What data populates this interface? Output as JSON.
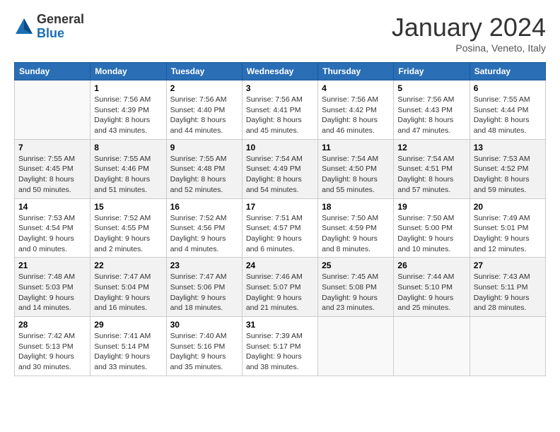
{
  "header": {
    "logo_general": "General",
    "logo_blue": "Blue",
    "month_title": "January 2024",
    "location": "Posina, Veneto, Italy"
  },
  "calendar": {
    "days_of_week": [
      "Sunday",
      "Monday",
      "Tuesday",
      "Wednesday",
      "Thursday",
      "Friday",
      "Saturday"
    ],
    "weeks": [
      [
        {
          "day": "",
          "info": ""
        },
        {
          "day": "1",
          "info": "Sunrise: 7:56 AM\nSunset: 4:39 PM\nDaylight: 8 hours\nand 43 minutes."
        },
        {
          "day": "2",
          "info": "Sunrise: 7:56 AM\nSunset: 4:40 PM\nDaylight: 8 hours\nand 44 minutes."
        },
        {
          "day": "3",
          "info": "Sunrise: 7:56 AM\nSunset: 4:41 PM\nDaylight: 8 hours\nand 45 minutes."
        },
        {
          "day": "4",
          "info": "Sunrise: 7:56 AM\nSunset: 4:42 PM\nDaylight: 8 hours\nand 46 minutes."
        },
        {
          "day": "5",
          "info": "Sunrise: 7:56 AM\nSunset: 4:43 PM\nDaylight: 8 hours\nand 47 minutes."
        },
        {
          "day": "6",
          "info": "Sunrise: 7:55 AM\nSunset: 4:44 PM\nDaylight: 8 hours\nand 48 minutes."
        }
      ],
      [
        {
          "day": "7",
          "info": "Sunrise: 7:55 AM\nSunset: 4:45 PM\nDaylight: 8 hours\nand 50 minutes."
        },
        {
          "day": "8",
          "info": "Sunrise: 7:55 AM\nSunset: 4:46 PM\nDaylight: 8 hours\nand 51 minutes."
        },
        {
          "day": "9",
          "info": "Sunrise: 7:55 AM\nSunset: 4:48 PM\nDaylight: 8 hours\nand 52 minutes."
        },
        {
          "day": "10",
          "info": "Sunrise: 7:54 AM\nSunset: 4:49 PM\nDaylight: 8 hours\nand 54 minutes."
        },
        {
          "day": "11",
          "info": "Sunrise: 7:54 AM\nSunset: 4:50 PM\nDaylight: 8 hours\nand 55 minutes."
        },
        {
          "day": "12",
          "info": "Sunrise: 7:54 AM\nSunset: 4:51 PM\nDaylight: 8 hours\nand 57 minutes."
        },
        {
          "day": "13",
          "info": "Sunrise: 7:53 AM\nSunset: 4:52 PM\nDaylight: 8 hours\nand 59 minutes."
        }
      ],
      [
        {
          "day": "14",
          "info": "Sunrise: 7:53 AM\nSunset: 4:54 PM\nDaylight: 9 hours\nand 0 minutes."
        },
        {
          "day": "15",
          "info": "Sunrise: 7:52 AM\nSunset: 4:55 PM\nDaylight: 9 hours\nand 2 minutes."
        },
        {
          "day": "16",
          "info": "Sunrise: 7:52 AM\nSunset: 4:56 PM\nDaylight: 9 hours\nand 4 minutes."
        },
        {
          "day": "17",
          "info": "Sunrise: 7:51 AM\nSunset: 4:57 PM\nDaylight: 9 hours\nand 6 minutes."
        },
        {
          "day": "18",
          "info": "Sunrise: 7:50 AM\nSunset: 4:59 PM\nDaylight: 9 hours\nand 8 minutes."
        },
        {
          "day": "19",
          "info": "Sunrise: 7:50 AM\nSunset: 5:00 PM\nDaylight: 9 hours\nand 10 minutes."
        },
        {
          "day": "20",
          "info": "Sunrise: 7:49 AM\nSunset: 5:01 PM\nDaylight: 9 hours\nand 12 minutes."
        }
      ],
      [
        {
          "day": "21",
          "info": "Sunrise: 7:48 AM\nSunset: 5:03 PM\nDaylight: 9 hours\nand 14 minutes."
        },
        {
          "day": "22",
          "info": "Sunrise: 7:47 AM\nSunset: 5:04 PM\nDaylight: 9 hours\nand 16 minutes."
        },
        {
          "day": "23",
          "info": "Sunrise: 7:47 AM\nSunset: 5:06 PM\nDaylight: 9 hours\nand 18 minutes."
        },
        {
          "day": "24",
          "info": "Sunrise: 7:46 AM\nSunset: 5:07 PM\nDaylight: 9 hours\nand 21 minutes."
        },
        {
          "day": "25",
          "info": "Sunrise: 7:45 AM\nSunset: 5:08 PM\nDaylight: 9 hours\nand 23 minutes."
        },
        {
          "day": "26",
          "info": "Sunrise: 7:44 AM\nSunset: 5:10 PM\nDaylight: 9 hours\nand 25 minutes."
        },
        {
          "day": "27",
          "info": "Sunrise: 7:43 AM\nSunset: 5:11 PM\nDaylight: 9 hours\nand 28 minutes."
        }
      ],
      [
        {
          "day": "28",
          "info": "Sunrise: 7:42 AM\nSunset: 5:13 PM\nDaylight: 9 hours\nand 30 minutes."
        },
        {
          "day": "29",
          "info": "Sunrise: 7:41 AM\nSunset: 5:14 PM\nDaylight: 9 hours\nand 33 minutes."
        },
        {
          "day": "30",
          "info": "Sunrise: 7:40 AM\nSunset: 5:16 PM\nDaylight: 9 hours\nand 35 minutes."
        },
        {
          "day": "31",
          "info": "Sunrise: 7:39 AM\nSunset: 5:17 PM\nDaylight: 9 hours\nand 38 minutes."
        },
        {
          "day": "",
          "info": ""
        },
        {
          "day": "",
          "info": ""
        },
        {
          "day": "",
          "info": ""
        }
      ]
    ]
  }
}
